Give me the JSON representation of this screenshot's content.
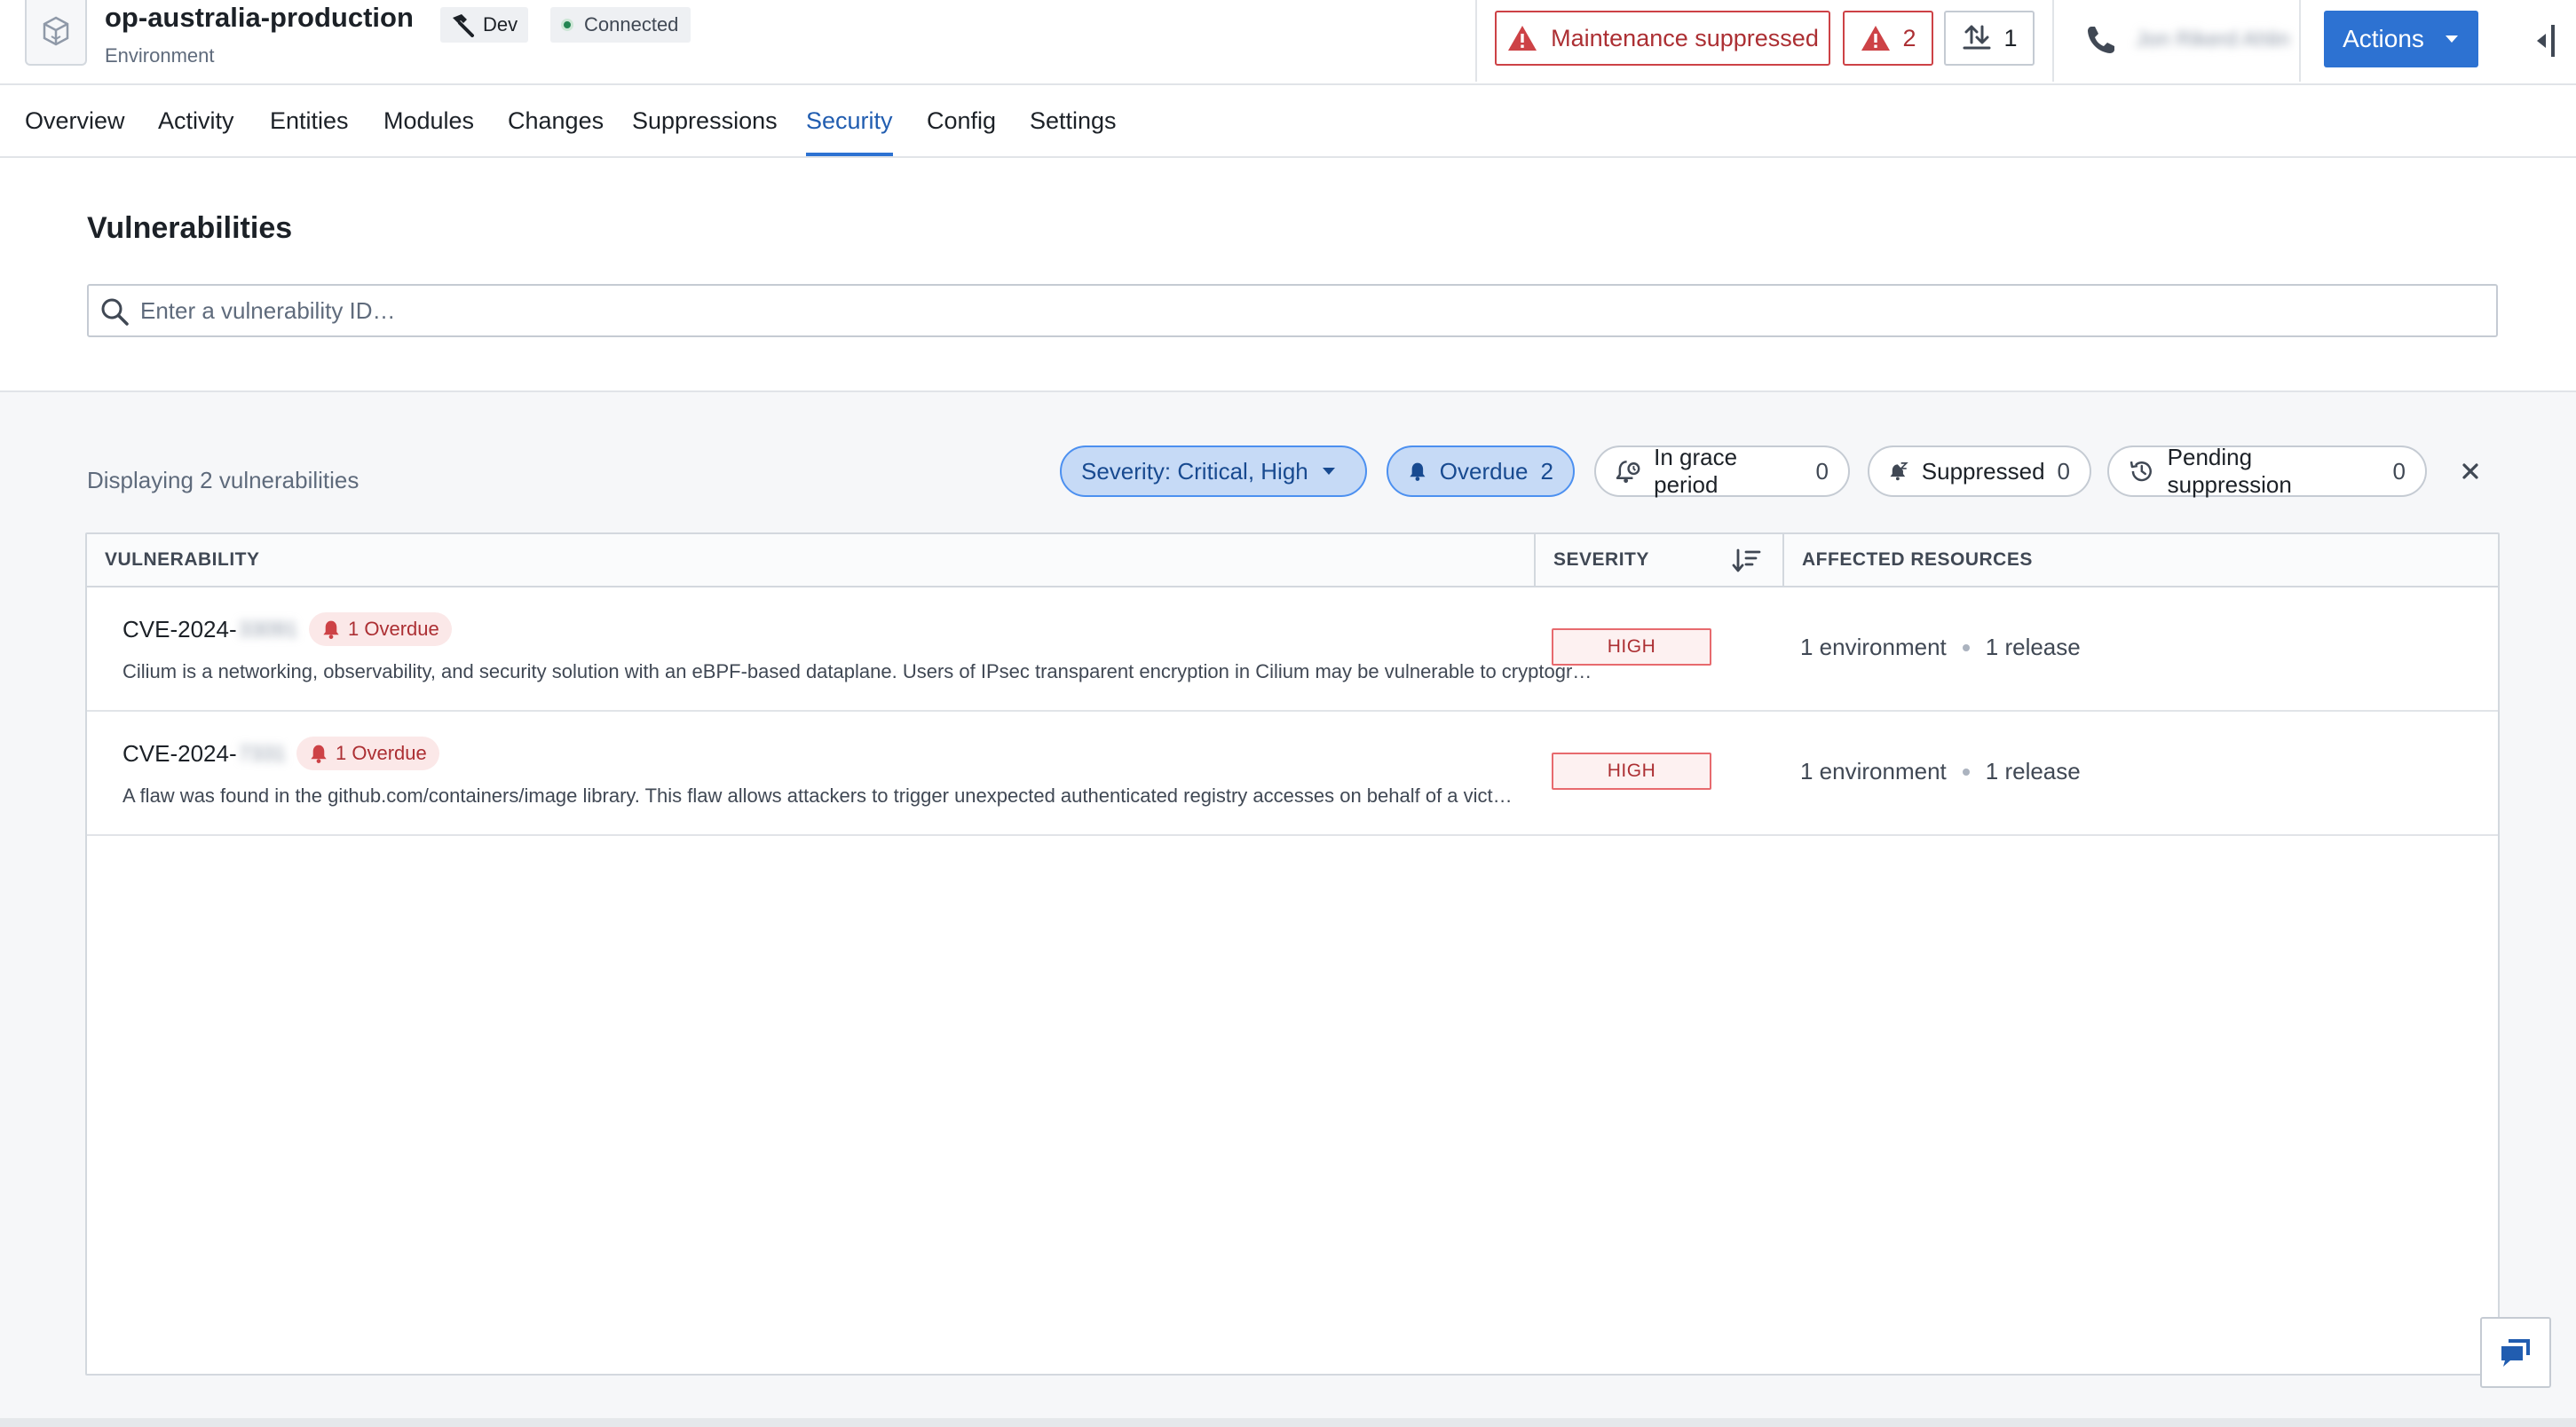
{
  "header": {
    "env_name": "op-australia-production",
    "env_type": "Environment",
    "tag_dev": "Dev",
    "tag_status": "Connected",
    "maintenance_label": "Maintenance suppressed",
    "alerts_count": "2",
    "uploads_count": "1",
    "actions_label": "Actions",
    "blurred_contact": "Jon Rikerd Ahlin"
  },
  "tabs": [
    {
      "label": "Overview"
    },
    {
      "label": "Activity"
    },
    {
      "label": "Entities"
    },
    {
      "label": "Modules"
    },
    {
      "label": "Changes"
    },
    {
      "label": "Suppressions"
    },
    {
      "label": "Security",
      "active": true
    },
    {
      "label": "Config"
    },
    {
      "label": "Settings"
    }
  ],
  "vulnerabilities": {
    "title": "Vulnerabilities",
    "search_placeholder": "Enter a vulnerability ID…",
    "count_text": "Displaying 2 vulnerabilities",
    "filters": {
      "severity": {
        "label": "Severity: Critical, High"
      },
      "overdue": {
        "label": "Overdue",
        "count": "2"
      },
      "grace": {
        "label": "In grace period",
        "count": "0"
      },
      "suppressed": {
        "label": "Suppressed",
        "count": "0"
      },
      "pending": {
        "label": "Pending suppression",
        "count": "0"
      }
    },
    "columns": {
      "vulnerability": "VULNERABILITY",
      "severity": "SEVERITY",
      "affected": "AFFECTED RESOURCES"
    },
    "rows": [
      {
        "id_prefix": "CVE-2024-",
        "id_blurred": "33091",
        "overdue": "1 Overdue",
        "description": "Cilium is a networking, observability, and security solution with an eBPF-based dataplane. Users of IPsec transparent encryption in Cilium may be vulnerable to cryptographic attacks",
        "severity": "HIGH",
        "environments": "1 environment",
        "releases": "1 release"
      },
      {
        "id_prefix": "CVE-2024-",
        "id_blurred": "7331",
        "overdue": "1 Overdue",
        "description": "A flaw was found in the github.com/containers/image library. This flaw allows attackers to trigger unexpected authenticated registry accesses on behalf of a victim user",
        "severity": "HIGH",
        "environments": "1 environment",
        "releases": "1 release"
      }
    ]
  },
  "colors": {
    "accent": "#2d72d2",
    "danger": "#cd4246",
    "connected": "#238551"
  }
}
